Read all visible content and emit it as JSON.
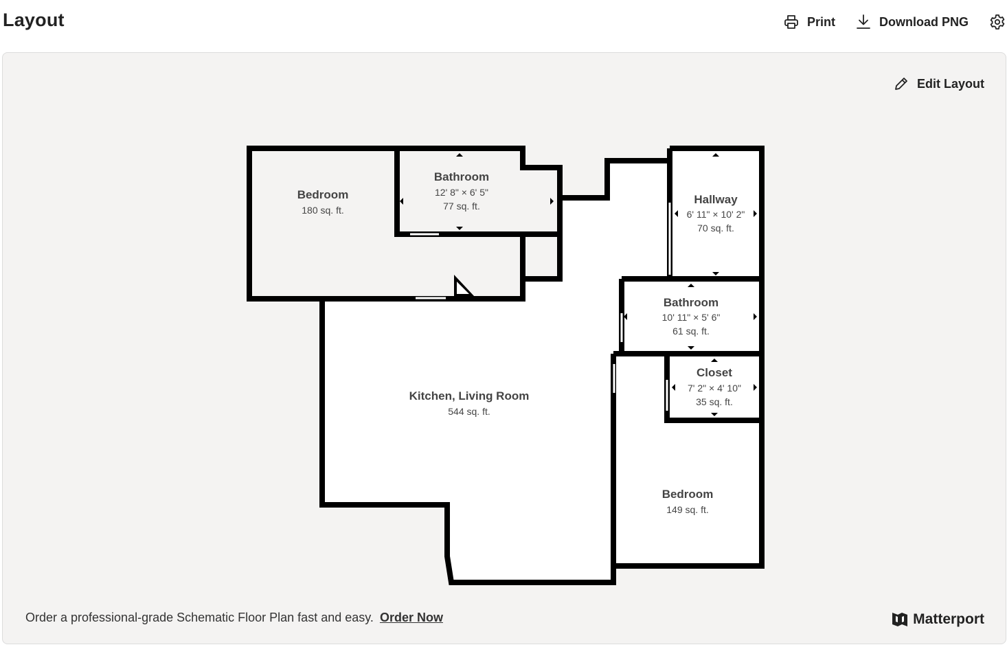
{
  "header": {
    "title": "Layout",
    "print_label": "Print",
    "download_label": "Download PNG"
  },
  "panel": {
    "edit_label": "Edit Layout",
    "footer_text": "Order a professional-grade Schematic Floor Plan fast and easy.",
    "order_link": "Order Now",
    "brand": "Matterport"
  },
  "rooms": [
    {
      "name": "Bedroom",
      "area": "180 sq. ft."
    },
    {
      "name": "Bathroom",
      "dims": "12' 8\" × 6' 5\"",
      "area": "77 sq. ft."
    },
    {
      "name": "Hallway",
      "dims": "6' 11\" × 10' 2\"",
      "area": "70 sq. ft."
    },
    {
      "name": "Bathroom",
      "dims": "10' 11\" × 5' 6\"",
      "area": "61 sq. ft."
    },
    {
      "name": "Closet",
      "dims": "7' 2\" × 4' 10\"",
      "area": "35 sq. ft."
    },
    {
      "name": "Kitchen, Living Room",
      "area": "544 sq. ft."
    },
    {
      "name": "Bedroom",
      "area": "149 sq. ft."
    }
  ],
  "icons": {
    "print": "printer-icon",
    "download": "download-icon",
    "settings": "gear-icon",
    "edit": "pencil-icon",
    "brand": "matterport-logo-icon"
  }
}
